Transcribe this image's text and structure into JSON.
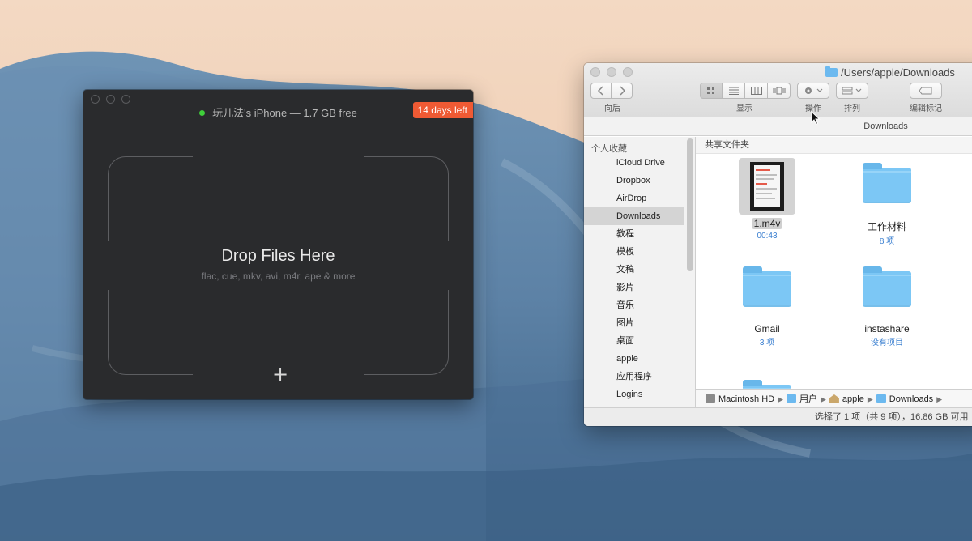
{
  "app": {
    "device_line": "玩儿法's iPhone — 1.7 GB free",
    "status_color": "#3fcf3a",
    "trial_badge": "14 days left",
    "drop_title": "Drop Files Here",
    "drop_subtitle": "flac, cue, mkv, avi, m4r, ape & more",
    "add_symbol": "+"
  },
  "finder": {
    "title": "/Users/apple/Downloads",
    "toolbar": {
      "back_label": "向后",
      "view_label": "显示",
      "action_label": "操作",
      "arrange_label": "排列",
      "tags_label": "编辑标记"
    },
    "header": "Downloads",
    "sidebar": {
      "section": "个人收藏",
      "items": [
        {
          "label": "iCloud Drive"
        },
        {
          "label": "Dropbox"
        },
        {
          "label": "AirDrop"
        },
        {
          "label": "Downloads",
          "selected": true
        },
        {
          "label": "教程"
        },
        {
          "label": "模板"
        },
        {
          "label": "文稿"
        },
        {
          "label": "影片"
        },
        {
          "label": "音乐"
        },
        {
          "label": "图片"
        },
        {
          "label": "桌面"
        },
        {
          "label": "apple"
        },
        {
          "label": "应用程序"
        },
        {
          "label": "Logins"
        }
      ]
    },
    "content_header": "共享文件夹",
    "items": [
      {
        "name": "1.m4v",
        "meta": "00:43",
        "kind": "video"
      },
      {
        "name": "工作材料",
        "meta": "8 项",
        "kind": "folder"
      },
      {
        "name": "Gmail",
        "meta": "3 项",
        "kind": "folder"
      },
      {
        "name": "instashare",
        "meta": "没有项目",
        "kind": "folder"
      }
    ],
    "pathbar": [
      "Macintosh HD",
      "用户",
      "apple",
      "Downloads"
    ],
    "status": "选择了 1 项（共 9 项），16.86 GB 可用"
  },
  "colors": {
    "trial_badge": "#ef5a34",
    "folder_blue": "#7cc7f5",
    "meta_blue": "#3a7fd0"
  }
}
